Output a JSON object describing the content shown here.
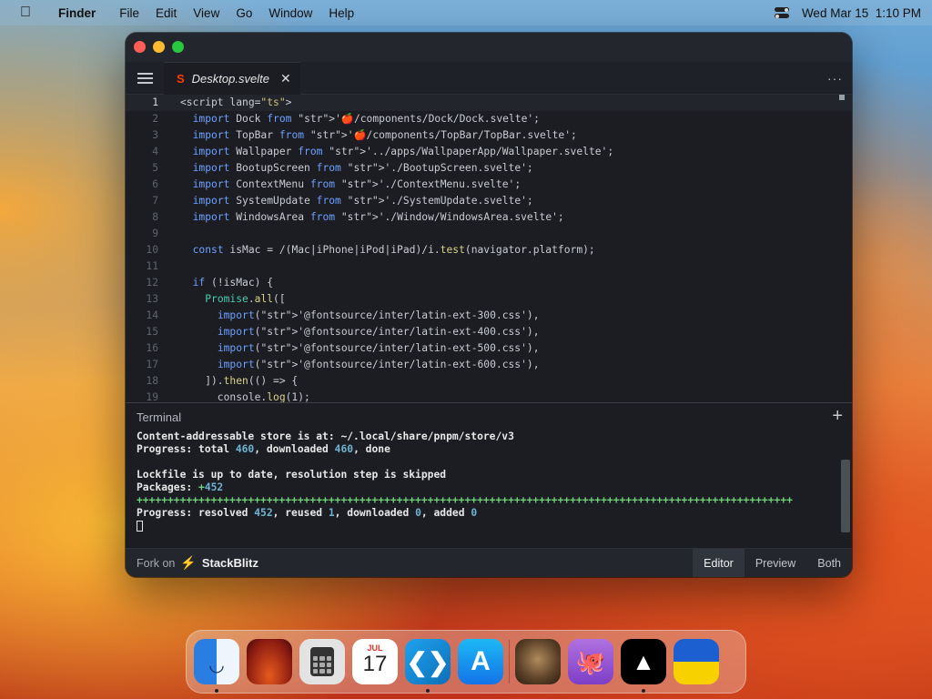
{
  "menubar": {
    "app_name": "Finder",
    "items": [
      "File",
      "Edit",
      "View",
      "Go",
      "Window",
      "Help"
    ],
    "datetime": "Wed Mar 15  1:10 PM"
  },
  "tab": {
    "filename": "Desktop.svelte"
  },
  "editor": {
    "lines": [
      {
        "n": "1",
        "text": "<script lang=\"ts\">"
      },
      {
        "n": "2",
        "text": "  import Dock from '🍎/components/Dock/Dock.svelte';"
      },
      {
        "n": "3",
        "text": "  import TopBar from '🍎/components/TopBar/TopBar.svelte';"
      },
      {
        "n": "4",
        "text": "  import Wallpaper from '../apps/WallpaperApp/Wallpaper.svelte';"
      },
      {
        "n": "5",
        "text": "  import BootupScreen from './BootupScreen.svelte';"
      },
      {
        "n": "6",
        "text": "  import ContextMenu from './ContextMenu.svelte';"
      },
      {
        "n": "7",
        "text": "  import SystemUpdate from './SystemUpdate.svelte';"
      },
      {
        "n": "8",
        "text": "  import WindowsArea from './Window/WindowsArea.svelte';"
      },
      {
        "n": "9",
        "text": ""
      },
      {
        "n": "10",
        "text": "  const isMac = /(Mac|iPhone|iPod|iPad)/i.test(navigator.platform);"
      },
      {
        "n": "11",
        "text": ""
      },
      {
        "n": "12",
        "text": "  if (!isMac) {"
      },
      {
        "n": "13",
        "text": "    Promise.all(["
      },
      {
        "n": "14",
        "text": "      import('@fontsource/inter/latin-ext-300.css'),"
      },
      {
        "n": "15",
        "text": "      import('@fontsource/inter/latin-ext-400.css'),"
      },
      {
        "n": "16",
        "text": "      import('@fontsource/inter/latin-ext-500.css'),"
      },
      {
        "n": "17",
        "text": "      import('@fontsource/inter/latin-ext-600.css'),"
      },
      {
        "n": "18",
        "text": "    ]).then(() => {"
      },
      {
        "n": "19",
        "text": "      console.log(1);"
      }
    ]
  },
  "terminal": {
    "title": "Terminal",
    "lines": [
      "Content-addressable store is at: ~/.local/share/pnpm/store/v3",
      "Progress: total 460, downloaded 460, done",
      "",
      "Lockfile is up to date, resolution step is skipped",
      "Packages: +452",
      "++++++++++++++++++++++++++++++++++++++++++++++++++++++++++++++++++++++++++++++++++++++++++++++++++++++++++",
      "Progress: resolved 452, reused 1, downloaded 0, added 0"
    ]
  },
  "footer": {
    "fork_label": "Fork on",
    "brand": "StackBlitz",
    "modes": [
      "Editor",
      "Preview",
      "Both"
    ],
    "active_mode": "Editor"
  },
  "calendar": {
    "month": "JUL",
    "day": "17"
  },
  "colors": {
    "accent_blue": "#1e90ff",
    "svelte_orange": "#ff3e00"
  }
}
